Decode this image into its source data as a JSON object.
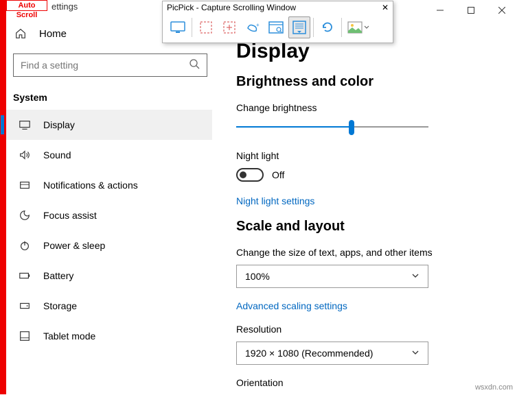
{
  "overlay": {
    "auto_scroll": "Auto Scroll",
    "settings_partial": "ettings"
  },
  "picpick": {
    "title": "PicPick - Capture Scrolling Window",
    "close": "✕"
  },
  "sidebar": {
    "home": "Home",
    "search_placeholder": "Find a setting",
    "section": "System",
    "items": [
      {
        "label": "Display"
      },
      {
        "label": "Sound"
      },
      {
        "label": "Notifications & actions"
      },
      {
        "label": "Focus assist"
      },
      {
        "label": "Power & sleep"
      },
      {
        "label": "Battery"
      },
      {
        "label": "Storage"
      },
      {
        "label": "Tablet mode"
      }
    ]
  },
  "main": {
    "page_title": "Display",
    "section1": "Brightness and color",
    "brightness_label": "Change brightness",
    "night_light_label": "Night light",
    "night_light_state": "Off",
    "night_light_link": "Night light settings",
    "section2": "Scale and layout",
    "scale_label": "Change the size of text, apps, and other items",
    "scale_value": "100%",
    "scale_link": "Advanced scaling settings",
    "res_label": "Resolution",
    "res_value": "1920 × 1080 (Recommended)",
    "orientation_label": "Orientation"
  },
  "watermark": "wsxdn.com"
}
